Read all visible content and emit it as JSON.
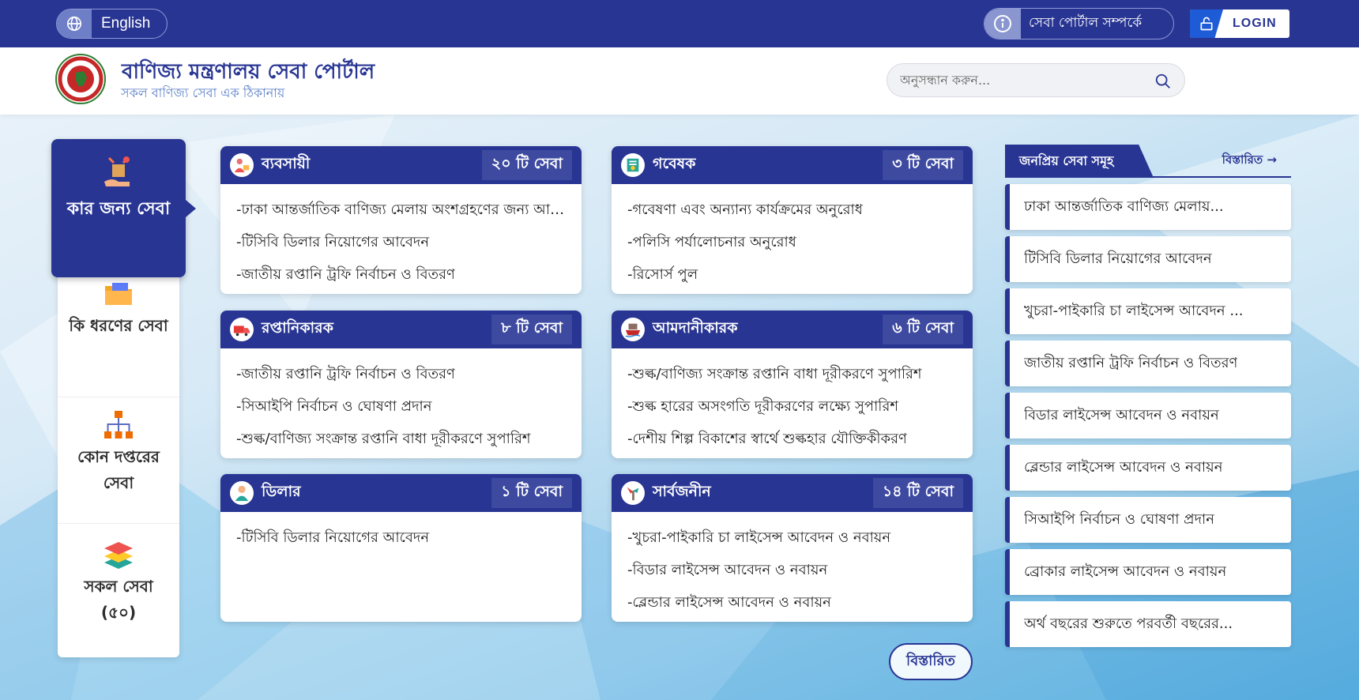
{
  "topbar": {
    "language": "English",
    "about": "সেবা পোর্টাল সম্পর্কে",
    "login": "LOGIN"
  },
  "header": {
    "title": "বাণিজ্য মন্ত্রণালয় সেবা পোর্টাল",
    "subtitle": "সকল বাণিজ্য সেবা এক ঠিকানায়",
    "search_placeholder": "অনুসন্ধান করুন..."
  },
  "sidebar": {
    "items": [
      {
        "label": "কার জন্য সেবা",
        "icon": "service-hand-icon",
        "active": true
      },
      {
        "label": "কি ধরণের সেবা",
        "icon": "folder-icon",
        "active": false
      },
      {
        "label": "কোন দপ্তরের সেবা",
        "icon": "org-chart-icon",
        "active": false
      },
      {
        "label": "সকল সেবা (৫০)",
        "icon": "layers-icon",
        "active": false
      }
    ]
  },
  "cards": [
    {
      "title": "ব্যবসায়ী",
      "count": "২০ টি সেবা",
      "icon": "businessman-icon",
      "items": [
        "-ঢাকা আন্তর্জাতিক বাণিজ্য মেলায় অংশগ্রহণের জন্য আবেদন",
        "-টিসিবি ডিলার নিয়োগের আবেদন",
        "-জাতীয় রপ্তানি ট্রফি নির্বাচন ও বিতরণ"
      ]
    },
    {
      "title": "গবেষক",
      "count": "৩ টি সেবা",
      "icon": "researcher-icon",
      "items": [
        "-গবেষণা এবং অন্যান্য কার্যক্রমের অনুরোধ",
        "-পলিসি পর্যালোচনার অনুরোধ",
        "-রিসোর্স পুল"
      ]
    },
    {
      "title": "রপ্তানিকারক",
      "count": "৮ টি সেবা",
      "icon": "truck-icon",
      "items": [
        "-জাতীয় রপ্তানি ট্রফি নির্বাচন ও বিতরণ",
        "-সিআইপি নির্বাচন ও ঘোষণা প্রদান",
        "-শুল্ক/বাণিজ্য সংক্রান্ত রপ্তানি বাধা দূরীকরণে সুপারিশ"
      ]
    },
    {
      "title": "আমদানীকারক",
      "count": "৬ টি সেবা",
      "icon": "ship-icon",
      "items": [
        "-শুল্ক/বাণিজ্য সংক্রান্ত রপ্তানি বাধা দূরীকরণে সুপারিশ",
        "-শুল্ক হারের অসংগতি দূরীকরণের লক্ষ্যে সুপারিশ",
        "-দেশীয় শিল্প বিকাশের স্বার্থে শুল্কহার যৌক্তিকীকরণ"
      ]
    },
    {
      "title": "ডিলার",
      "count": "১ টি সেবা",
      "icon": "dealer-icon",
      "items": [
        "-টিসিবি ডিলার নিয়োগের আবেদন"
      ]
    },
    {
      "title": "সার্বজনীন",
      "count": "১৪ টি সেবা",
      "icon": "public-icon",
      "items": [
        "-খুচরা-পাইকারি চা লাইসেন্স আবেদন ও নবায়ন",
        "-বিডার লাইসেন্স আবেদন ও নবায়ন",
        "-ব্লেন্ডার লাইসেন্স আবেদন ও নবায়ন"
      ]
    }
  ],
  "popular": {
    "title": "জনপ্রিয় সেবা সমূহ",
    "more": "বিস্তারিত",
    "items": [
      "ঢাকা আন্তর্জাতিক বাণিজ্য মেলায়...",
      "টিসিবি ডিলার নিয়োগের আবেদন",
      "খুচরা-পাইকারি চা লাইসেন্স আবেদন ...",
      "জাতীয় রপ্তানি ট্রফি নির্বাচন ও বিতরণ",
      "বিডার লাইসেন্স আবেদন ও নবায়ন",
      "ব্লেন্ডার লাইসেন্স আবেদন ও নবায়ন",
      "সিআইপি নির্বাচন ও ঘোষণা প্রদান",
      "ব্রোকার লাইসেন্স আবেদন ও নবায়ন",
      "অর্থ বছরের শুরুতে পরবর্তী বছরের..."
    ]
  },
  "more_button": "বিস্তারিত",
  "colors": {
    "primary": "#283593",
    "badge": "#3d4aa0",
    "accent": "#1e5bd6"
  }
}
